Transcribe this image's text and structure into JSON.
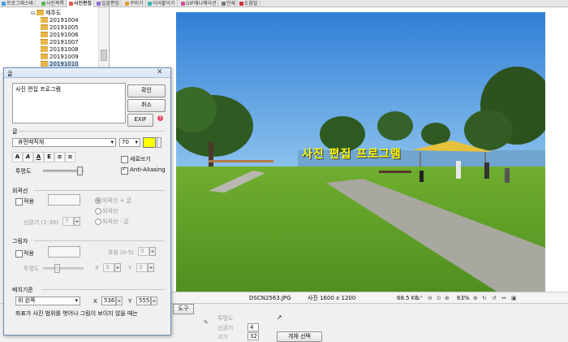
{
  "top_tabs": [
    "프로그래스바",
    "사진목록",
    "사진편집",
    "일괄편집",
    "꾸미기",
    "이어붙이기",
    "GIF애니메이션",
    "인쇄",
    "도움말"
  ],
  "tree": {
    "root": "제주도",
    "folders": [
      "20191004",
      "20191005",
      "20191006",
      "20191007",
      "20191008",
      "20191009",
      "20191010"
    ]
  },
  "dialog": {
    "title": "글",
    "textarea": "사진 편집 프로그램",
    "ok": "확인",
    "cancel": "취소",
    "exif": "EXIF",
    "font_section": "글",
    "font_name": "휴먼매직체",
    "font_size": "70",
    "format_buttons": [
      "A",
      "A",
      "A",
      "E",
      "≡",
      "≡"
    ],
    "vertical_label": "세로쓰기",
    "antialias_label": "Anti-Aliasing",
    "opacity_label": "투명도",
    "outline": {
      "section": "외곽선",
      "apply": "적용",
      "thickness_label": "선굵기 (1-36)",
      "thickness": "7",
      "options": [
        "외곽선 + 글",
        "외곽선",
        "외곽선 - 글"
      ]
    },
    "shadow": {
      "section": "그림자",
      "apply": "적용",
      "blur_label": "흐림 (0-5)",
      "blur": "0",
      "opacity_label": "투명도",
      "x_label": "X",
      "x": "3",
      "y_label": "Y",
      "y": "3"
    },
    "placement": {
      "section": "배치기준",
      "align": "위 왼쪽",
      "x_label": "X",
      "x": "536",
      "y_label": "Y",
      "y": "555"
    },
    "note": "좌표가 사진 범위를 벗어나 그림이 보이지 않을 때는"
  },
  "overlay_text": "사진 편집 프로그램",
  "status": {
    "filename": "DSCN2563.JPG",
    "dimensions": "사진 1600 x 1200",
    "filesize": "68.5 KB",
    "zoom": "63%"
  },
  "bottom": {
    "tool_tab": "도구",
    "opacity_label": "투명도",
    "thickness_label": "선굵기",
    "thickness_value": "4",
    "size_label": "크기",
    "size_value": "32",
    "object_select": "개체 선택"
  },
  "colors": {
    "text_color": "#ffff00",
    "accent": "#4a78b5"
  }
}
